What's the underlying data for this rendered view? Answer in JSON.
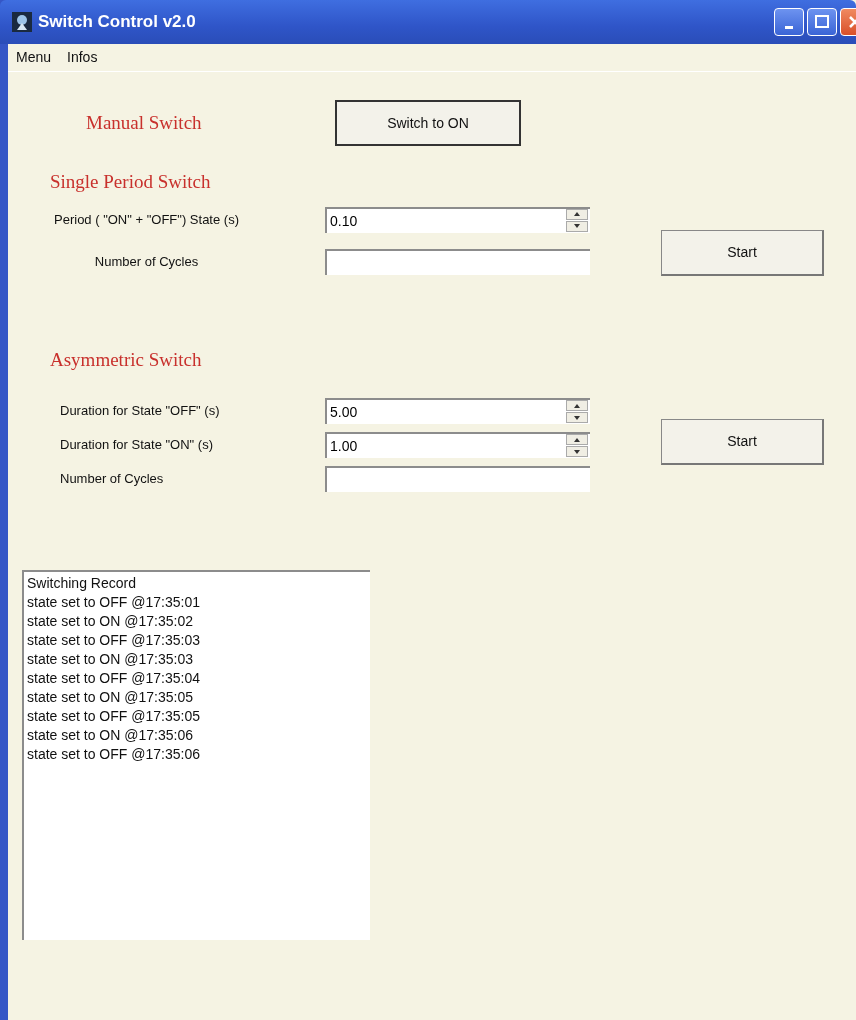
{
  "window": {
    "title": "Switch Control v2.0"
  },
  "menu": [
    "Menu",
    "Infos"
  ],
  "manual": {
    "label": "Manual Switch",
    "button": "Switch to ON"
  },
  "single_period": {
    "heading": "Single Period Switch",
    "button": "Start",
    "fields": [
      {
        "label": "Period ( \"ON\" + \"OFF\") State (s)",
        "kind": "spinner",
        "value": "0.10"
      },
      {
        "label": "Number of Cycles",
        "kind": "text"
      }
    ]
  },
  "asymmetric": {
    "heading": "Asymmetric Switch",
    "button": "Start",
    "fields": [
      {
        "label": "Duration for State \"OFF\" (s)",
        "kind": "spinner",
        "value": "5.00"
      },
      {
        "label": "Duration for State \"ON\" (s)",
        "kind": "spinner",
        "value": "1.00"
      },
      {
        "label": "Number of Cycles",
        "kind": "text"
      }
    ]
  },
  "log": [
    "Switching Record",
    "state set to OFF @17:35:01",
    "state set to ON @17:35:02",
    "state set to OFF @17:35:03",
    "state set to ON @17:35:03",
    "state set to OFF @17:35:04",
    "state set to ON @17:35:05",
    "state set to OFF @17:35:05",
    "state set to ON @17:35:06",
    "state set to OFF @17:35:06"
  ]
}
